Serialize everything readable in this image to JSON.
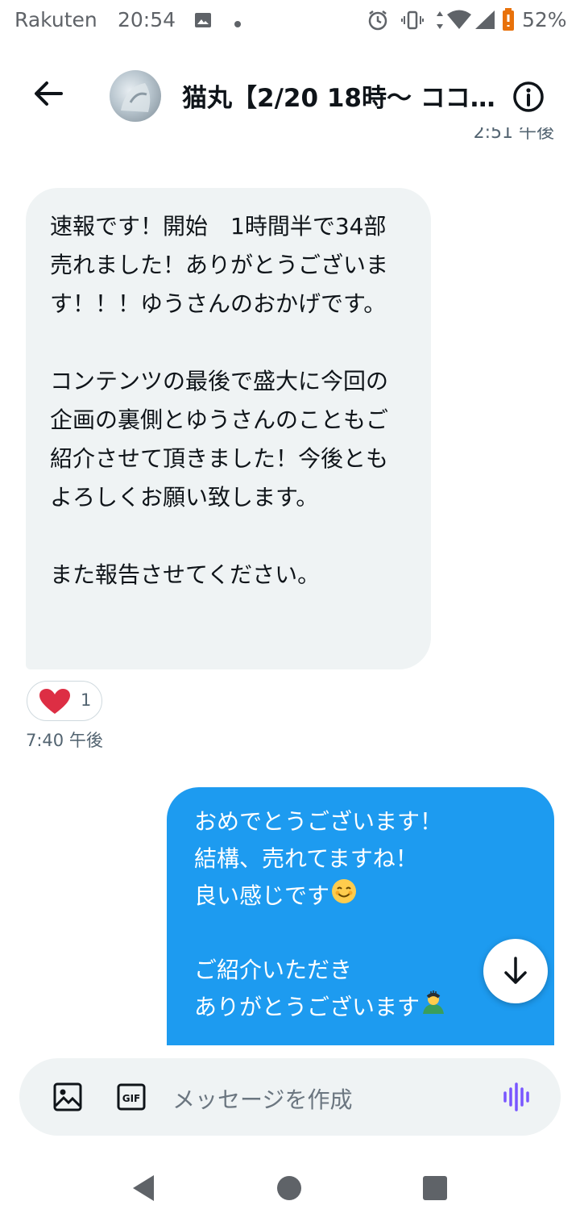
{
  "status_bar": {
    "carrier": "Rakuten",
    "time": "20:54",
    "battery": "52%",
    "icons": [
      "image-icon",
      "dot-icon",
      "alarm-icon",
      "vibrate-icon",
      "data-arrows-icon",
      "wifi-icon",
      "signal-icon",
      "battery-icon"
    ]
  },
  "header": {
    "title": "猫丸【2/20 18時〜 ココ…",
    "previous_time_partial": "2:51 午後"
  },
  "incoming_message": {
    "text": "速報です！開始　1時間半で34部売れました！ありがとうございます！！！ゆうさんのおかげです。\n\nコンテンツの最後で盛大に今回の企画の裏側とゆうさんのこともご紹介させて頂きました！今後ともよろしくお願い致します。\n\nまた報告させてください。",
    "reaction_emoji": "heart",
    "reaction_count": "1",
    "time": "7:40 午後"
  },
  "outgoing_message": {
    "line1": "おめでとうございます！",
    "line2": "結構、売れてますね！",
    "line3": "良い感じです",
    "line4": "ご紹介いただき",
    "line5": "ありがとうございます",
    "emoji_after_line3": "smiling-face",
    "emoji_after_line5": "bowing-person"
  },
  "composer": {
    "placeholder": "メッセージを作成",
    "buttons": [
      "image-icon",
      "gif-icon",
      "voice-icon"
    ]
  },
  "colors": {
    "accent": "#1d9bf0",
    "incoming_bubble": "#eff3f4",
    "voice_icon": "#7856ff",
    "heart": "#e0245e"
  }
}
